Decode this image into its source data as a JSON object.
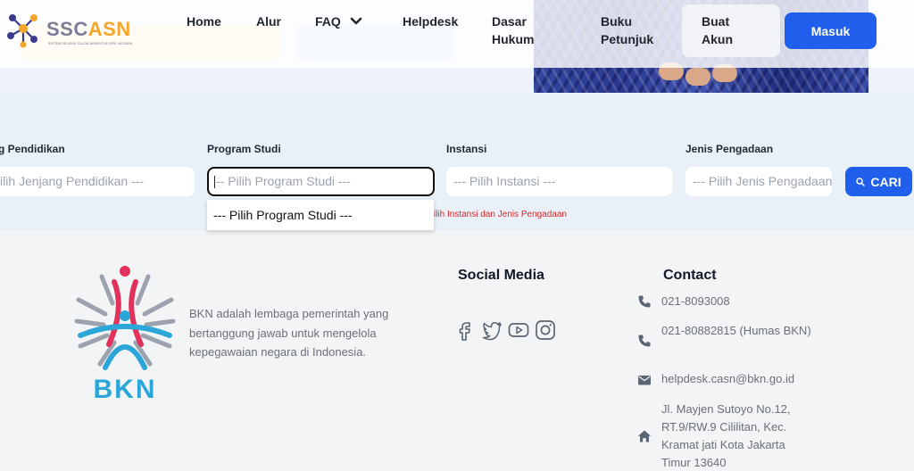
{
  "brand": {
    "name_part1": "SSC",
    "name_part2": "ASN",
    "tagline": "SISTEM SELEKSI CALON APARATUR SIPIL NEGARA"
  },
  "nav": {
    "home": "Home",
    "alur": "Alur",
    "faq": "FAQ",
    "helpdesk": "Helpdesk",
    "dasar_hukum_1": "Dasar",
    "dasar_hukum_2": "Hukum",
    "buku_petunjuk_1": "Buku",
    "buku_petunjuk_2": "Petunjuk",
    "buat_akun_1": "Buat",
    "buat_akun_2": "Akun",
    "masuk": "Masuk"
  },
  "filters": {
    "jenjang_label": "g Pendidikan",
    "jenjang_placeholder": "ilih Jenjang Pendidikan ---",
    "prodi_label": "Program Studi",
    "prodi_placeholder": "-- Pilih Program Studi ---",
    "prodi_option": "--- Pilih Program Studi ---",
    "instansi_label": "Instansi",
    "instansi_placeholder": "--- Pilih Instansi ---",
    "pengadaan_label": "Jenis Pengadaan",
    "pengadaan_placeholder": "--- Pilih Jenis Pengadaan ---",
    "hint": "ilih Instansi dan Jenis Pengadaan",
    "search_button": "CARI"
  },
  "footer": {
    "org_logo_text": "BKN",
    "about": "BKN adalah lembaga pemerintah yang bertanggung jawab untuk mengelola kepegawaian negara di Indonesia.",
    "social_title": "Social Media",
    "contact_title": "Contact",
    "phone_1": "021-8093008",
    "phone_2": "021-80882815 (Humas BKN)",
    "email": "helpdesk.casn@bkn.go.id",
    "address": "Jl. Mayjen Sutoyo No.12, RT.9/RW.9 Cililitan, Kec. Kramat jati Kota Jakarta Timur 13640"
  },
  "colors": {
    "primary": "#1f5fec",
    "accent_orange": "#f4a52a",
    "error": "#e02424",
    "logo_red": "#e2315b",
    "logo_blue": "#2aa6d9"
  },
  "icons": [
    "facebook-icon",
    "twitter-icon",
    "youtube-icon",
    "instagram-icon",
    "phone-icon",
    "email-icon",
    "home-icon",
    "search-icon",
    "chevron-down-icon"
  ]
}
